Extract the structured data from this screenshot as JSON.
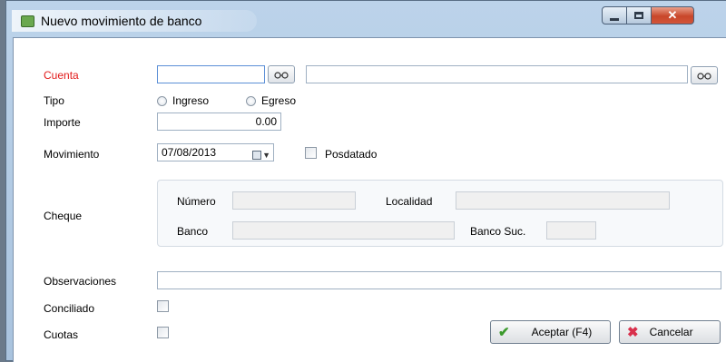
{
  "window": {
    "title": "Nuevo movimiento de banco"
  },
  "form": {
    "cuenta": {
      "label": "Cuenta",
      "code_value": "",
      "name_value": ""
    },
    "tipo": {
      "label": "Tipo",
      "options": [
        "Ingreso",
        "Egreso"
      ]
    },
    "importe": {
      "label": "Importe",
      "value": "0.00"
    },
    "movimiento": {
      "label": "Movimiento",
      "date_value": "07/08/2013",
      "posdatado_label": "Posdatado"
    },
    "cheque": {
      "label": "Cheque",
      "numero_label": "Número",
      "localidad_label": "Localidad",
      "banco_label": "Banco",
      "banco_suc_label": "Banco Suc."
    },
    "observaciones": {
      "label": "Observaciones",
      "value": ""
    },
    "conciliado": {
      "label": "Conciliado"
    },
    "cuotas": {
      "label": "Cuotas"
    }
  },
  "buttons": {
    "accept": "Aceptar (F4)",
    "cancel": "Cancelar"
  },
  "icons": {
    "search": "binoculars-icon",
    "accept": "check-icon",
    "cancel": "x-icon"
  },
  "colors": {
    "required_label": "#e21b1b",
    "titlebar": "#bcd3ea"
  }
}
